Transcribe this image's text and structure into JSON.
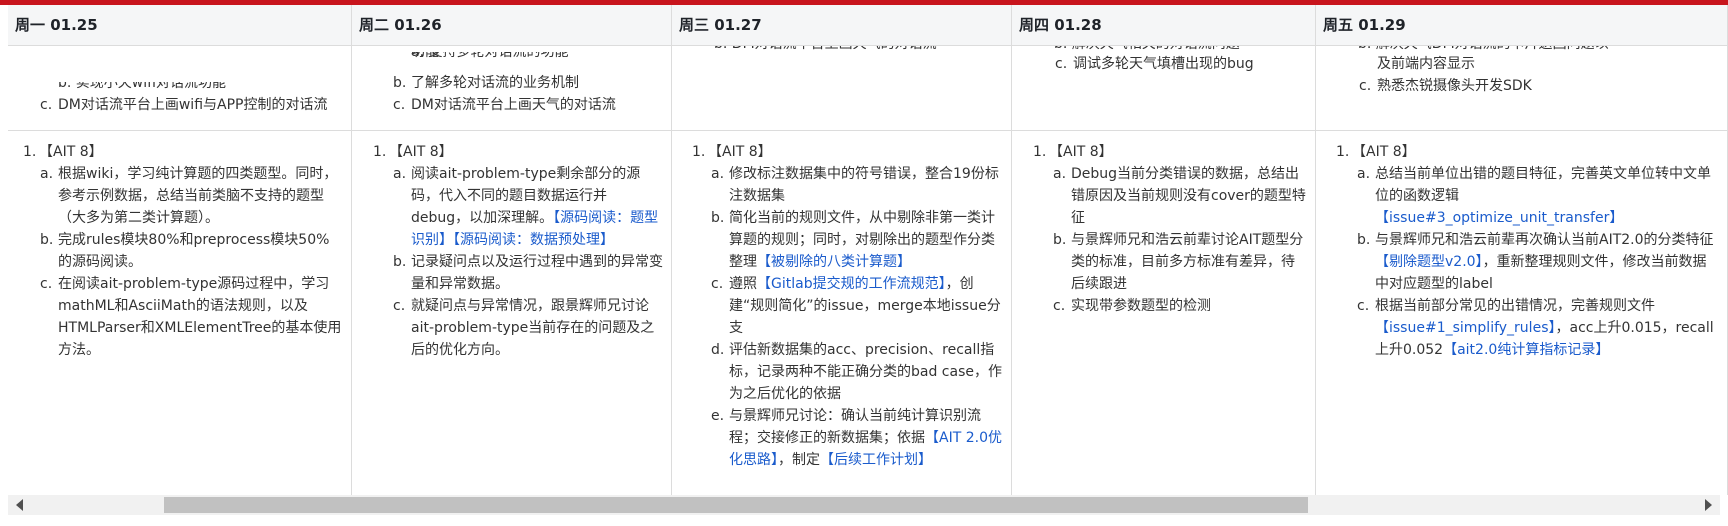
{
  "header": [
    "周一 01.25",
    "周二 01.26",
    "周三 01.27",
    "周四 01.28",
    "周五 01.29"
  ],
  "row1": {
    "mon": {
      "b_text": "b. 实现小天wifi对话流功能",
      "c_text": "DM对话流平台上画wifi与APP控制的对话流"
    },
    "tue": {
      "a_text": "a. 支持多轮对话流的功能",
      "b_text": "了解多轮对话流的业务机制",
      "c_text": "DM对话流平台上画天气的对话流"
    },
    "wed": {
      "a_text": "b. DM对话流平台上画天气的对话流"
    },
    "thu": {
      "b_text": "b. 解决天气相关的对话流问题",
      "c_text": "调试多轮天气填槽出现的bug"
    },
    "fri": {
      "b_text": "b. 解决天气DM对话流的卡片返回问题以",
      "b2": "及前端内容显示",
      "c_text": "熟悉杰锐摄像头开发SDK"
    }
  },
  "markers": {
    "a": "a.",
    "b": "b.",
    "c": "c.",
    "d": "d.",
    "e": "e.",
    "one": "1."
  },
  "project": "【AIT 8】",
  "mon": {
    "a": "根据wiki，学习纯计算题的四类题型。同时，参考示例数据，总结当前类脑不支持的题型（大多为第二类计算题）。",
    "b": "完成rules模块80%和preprocess模块50%的源码阅读。",
    "c": "在阅读ait-problem-type源码过程中，学习mathML和AsciiMath的语法规则，以及HTMLParser和XMLElementTree的基本使用方法。"
  },
  "tue": {
    "a": "阅读ait-problem-type剩余部分的源码，代入不同的题目数据运行并debug，以加深理解。",
    "a_link1": "【源码阅读：题型识别】",
    "a_link2": "【源码阅读：数据预处理】",
    "b": "记录疑问点以及运行过程中遇到的异常变量和异常数据。",
    "c": "就疑问点与异常情况，跟景辉师兄讨论ait-problem-type当前存在的问题及之后的优化方向。"
  },
  "wed": {
    "a": "修改标注数据集中的符号错误，整合19份标注数据集",
    "b": "简化当前的规则文件，从中剔除非第一类计算题的规则；同时，对剔除出的题型作分类整理",
    "b_link": "【被剔除的八类计算题】",
    "c_pre": "遵照",
    "c_link": "【Gitlab提交规的工作流规范】",
    "c_post": "，创建“规则简化”的issue，merge本地issue分支",
    "d": "评估新数据集的acc、precision、recall指标，记录两种不能正确分类的bad case，作为之后优化的依据",
    "e_pre": "与景辉师兄讨论：确认当前纯计算识别流程；交接修正的新数据集；依据",
    "e_link1": "【AIT 2.0优化思路】",
    "e_mid": "，制定",
    "e_link2": "【后续工作计划】"
  },
  "thu": {
    "a": "Debug当前分类错误的数据，总结出错原因及当前规则没有cover的题型特征",
    "b": "与景辉师兄和浩云前辈讨论AIT题型分类的标准，目前多方标准有差异，待后续跟进",
    "c": "实现带参数题型的检测"
  },
  "fri": {
    "a": "总结当前单位出错的题目特征，完善英文单位转中文单位的函数逻辑",
    "a_link": "【issue#3_optimize_unit_transfer】",
    "b_pre": "与景辉师兄和浩云前辈再次确认当前AIT2.0的分类特征",
    "b_link": "【剔除题型v2.0】",
    "b_post": "，重新整理规则文件，修改当前数据中对应题型的label",
    "c_pre": "根据当前部分常见的出错情况，完善规则文件",
    "c_link1": "【issue#1_simplify_rules】",
    "c_mid": "，acc上升0.015，recall上升0.052",
    "c_link2": "【ait2.0纯计算指标记录】"
  },
  "colors": {
    "accent": "#c8151d",
    "link": "#1a5bcc",
    "header_bg": "#f5f6f7"
  }
}
